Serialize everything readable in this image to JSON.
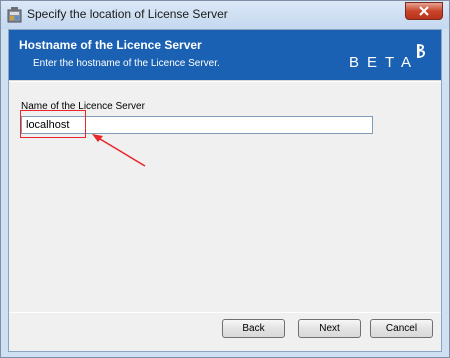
{
  "window": {
    "title": "Specify the location of License Server",
    "icon": "installer-icon",
    "close_icon": "close-icon"
  },
  "banner": {
    "title": "Hostname of the Licence Server",
    "subtitle": "Enter the hostname of the Licence Server.",
    "logo_text": "BETA",
    "background_color": "#1a61b3"
  },
  "form": {
    "label": "Name of the Licence Server",
    "hostname_value": "localhost"
  },
  "annotation": {
    "highlight_color": "#e8262c"
  },
  "buttons": {
    "back_label": "Back",
    "next_label": "Next",
    "cancel_label": "Cancel"
  }
}
